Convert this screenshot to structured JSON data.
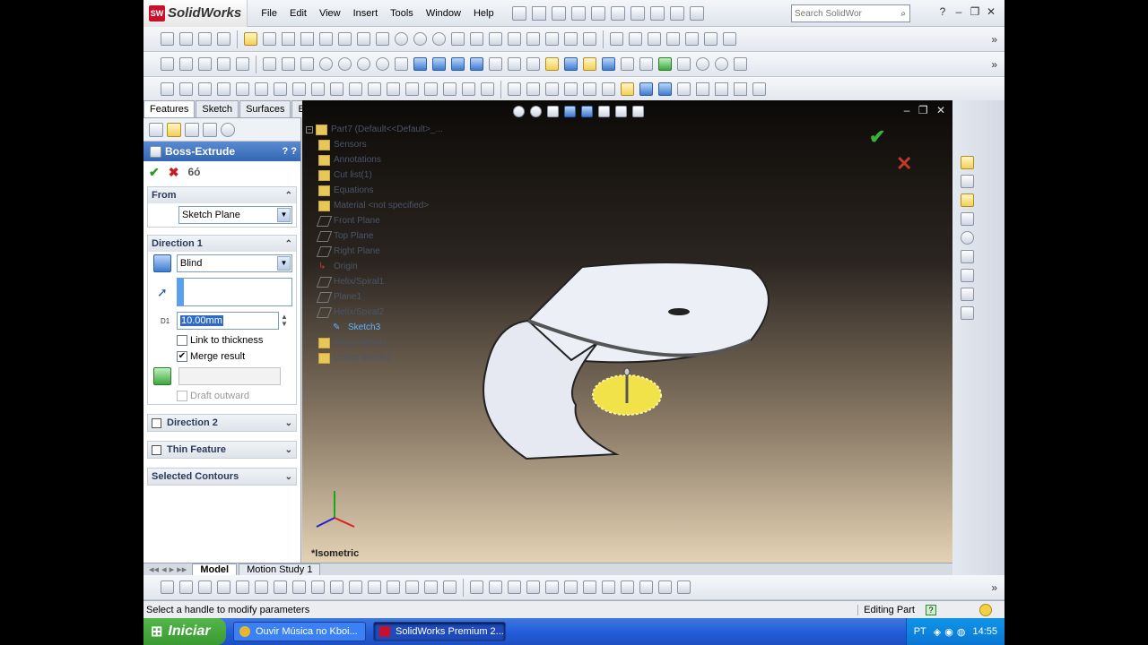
{
  "app": {
    "name": "SolidWorks",
    "logo": "SW"
  },
  "menu": [
    "File",
    "Edit",
    "View",
    "Insert",
    "Tools",
    "Window",
    "Help"
  ],
  "search": {
    "placeholder": "Search SolidWor"
  },
  "cm_tabs": [
    "Features",
    "Sketch",
    "Surfaces",
    "Evaluate"
  ],
  "feature": {
    "title": "Boss-Extrude",
    "help": "? ?",
    "from_label": "From",
    "from_value": "Sketch Plane",
    "dir1_label": "Direction 1",
    "dir1_type": "Blind",
    "depth": "10.00mm",
    "depth_tag": "D1",
    "link_thickness": "Link to thickness",
    "merge_result": "Merge result",
    "draft_outward": "Draft outward",
    "dir2_label": "Direction 2",
    "thin_label": "Thin Feature",
    "contours_label": "Selected Contours"
  },
  "tree": [
    "Part7  (Default<<Default>_...",
    "Sensors",
    "Annotations",
    "Cut list(1)",
    "Equations",
    "Material <not specified>",
    "Front Plane",
    "Top Plane",
    "Right Plane",
    "Origin",
    "Helix/Spiral1",
    "Plane1",
    "Helix/Spiral2",
    "Sketch3",
    "Sheet-Metal1",
    "Lofted Bends1"
  ],
  "view_label": "*Isometric",
  "bottom_tabs": [
    "Model",
    "Motion Study 1"
  ],
  "status": {
    "left": "Select a handle to modify parameters",
    "mode": "Editing Part"
  },
  "taskbar": {
    "start": "Iniciar",
    "tasks": [
      "Ouvir Música no Kboi...",
      "SolidWorks Premium 2..."
    ],
    "lang": "PT",
    "time": "14:55"
  },
  "colors": {
    "accent": "#3366b3",
    "model": "#e8ecf5",
    "selection": "#f2e24a"
  }
}
